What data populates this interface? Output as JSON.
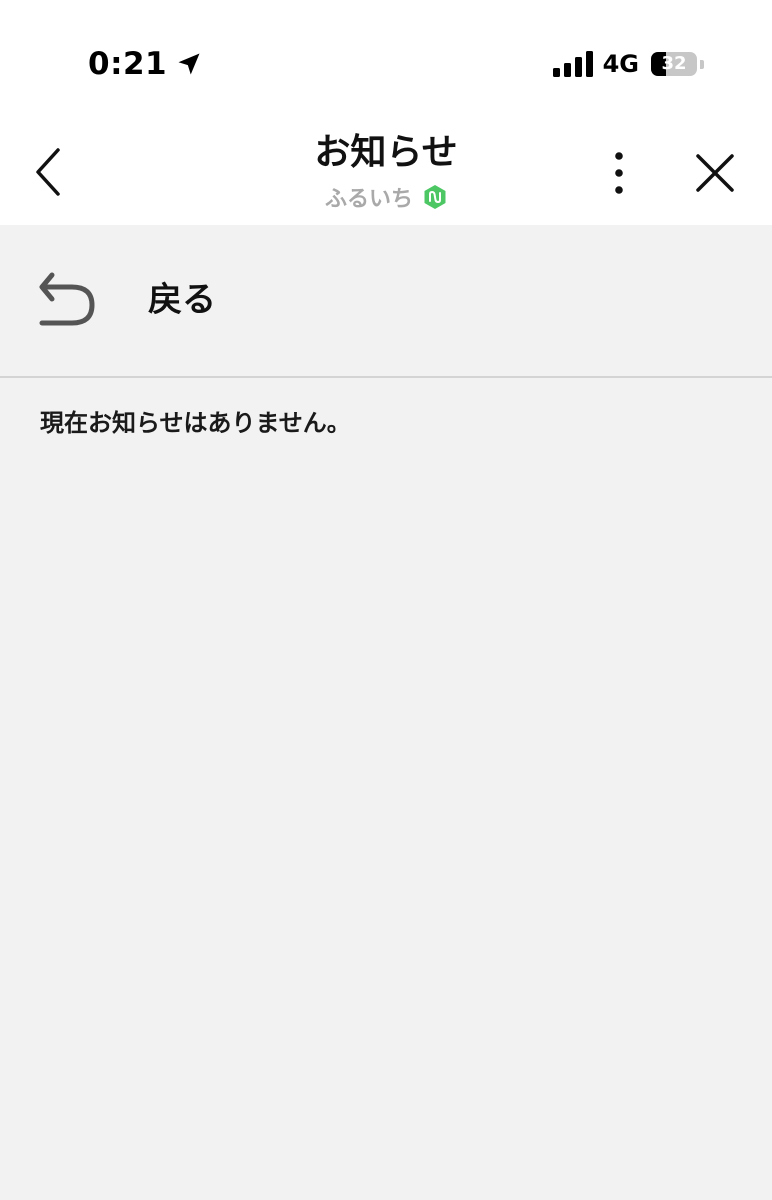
{
  "status_bar": {
    "time": "0:21",
    "network": "4G",
    "battery_level": "32",
    "battery_fraction": 0.32
  },
  "header": {
    "title": "お知らせ",
    "subtitle": "ふるいち"
  },
  "content": {
    "back_label": "戻る",
    "empty_message": "現在お知らせはありません。"
  },
  "icons": {
    "location": "location-arrow-icon",
    "signal": "signal-bars-icon",
    "back": "chevron-left-icon",
    "verified": "verified-badge-icon",
    "more": "more-vertical-icon",
    "close": "close-icon",
    "return": "return-arrow-icon"
  },
  "colors": {
    "background": "#f2f2f2",
    "header_background": "#ffffff",
    "subtitle": "#a9a9a9",
    "verified_badge": "#4cc764",
    "return_icon": "#555555",
    "divider": "#d4d4d4"
  }
}
